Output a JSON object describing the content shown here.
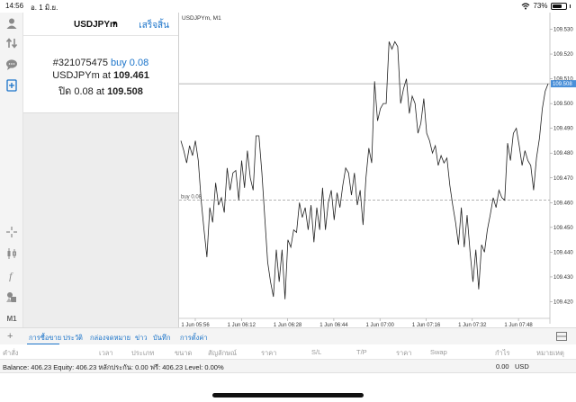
{
  "status": {
    "time": "14:56",
    "date": "อ. 1 มิ.ย.",
    "battery": "73%",
    "battery_level": 0.73
  },
  "panel": {
    "symbol": "USDJPYm",
    "done_label": "เสร็จสิ้น",
    "order_id": "#321075475",
    "order_action": "buy 0.08",
    "open_prefix": "USDJPYm at",
    "open_price": "109.461",
    "close_prefix": "ปิด 0.08 at",
    "close_price": "109.508"
  },
  "toolbar": {
    "timeframe_label": "M1"
  },
  "chart": {
    "title": "USDJPYm, M1",
    "buy_label": "buy 0.08",
    "current_price_label": "109.508"
  },
  "chart_data": {
    "type": "line",
    "title": "USDJPYm, M1",
    "y_ticks": [
      "109.530",
      "109.520",
      "109.510",
      "109.500",
      "109.490",
      "109.480",
      "109.470",
      "109.460",
      "109.450",
      "109.440",
      "109.430",
      "109.420"
    ],
    "x_ticks": [
      "1 Jun 05:56",
      "1 Jun 06:12",
      "1 Jun 06:28",
      "1 Jun 06:44",
      "1 Jun 07:00",
      "1 Jun 07:16",
      "1 Jun 07:32",
      "1 Jun 07:48"
    ],
    "ylim": [
      109.414,
      109.536
    ],
    "buy_level": 109.461,
    "current_level": 109.508,
    "grid": false,
    "y": [
      109.485,
      109.481,
      109.476,
      109.483,
      109.479,
      109.485,
      109.477,
      109.461,
      109.449,
      109.438,
      109.458,
      109.452,
      109.468,
      109.459,
      109.462,
      109.456,
      109.474,
      109.465,
      109.472,
      109.473,
      109.461,
      109.477,
      109.466,
      109.481,
      109.47,
      109.465,
      109.487,
      109.487,
      109.472,
      109.454,
      109.436,
      109.428,
      109.422,
      109.441,
      109.428,
      109.441,
      109.421,
      109.445,
      109.442,
      109.449,
      109.448,
      109.46,
      109.454,
      109.458,
      109.449,
      109.459,
      109.444,
      109.458,
      109.449,
      109.466,
      109.449,
      109.46,
      109.465,
      109.453,
      109.464,
      109.458,
      109.467,
      109.474,
      109.472,
      109.463,
      109.472,
      109.459,
      109.465,
      109.451,
      109.47,
      109.482,
      109.476,
      109.509,
      109.493,
      109.498,
      109.5,
      109.5,
      109.525,
      109.522,
      109.525,
      109.523,
      109.5,
      109.506,
      109.51,
      109.496,
      109.503,
      109.5,
      109.488,
      109.492,
      109.502,
      109.488,
      109.485,
      109.48,
      109.483,
      109.475,
      109.479,
      109.476,
      109.478,
      109.467,
      109.459,
      109.452,
      109.443,
      109.458,
      109.442,
      109.455,
      109.44,
      109.428,
      109.441,
      109.425,
      109.443,
      109.44,
      109.449,
      109.455,
      109.462,
      109.458,
      109.465,
      109.462,
      109.461,
      109.484,
      109.477,
      109.488,
      109.49,
      109.483,
      109.475,
      109.481,
      109.477,
      109.475,
      109.465,
      109.478,
      109.486,
      109.498,
      109.505,
      109.508
    ]
  },
  "tabs": {
    "items": [
      "การซื้อขาย",
      "ประวัติ",
      "กล่องจดหมาย",
      "ข่าว",
      "บันทึก",
      "การตั้งค่า"
    ]
  },
  "columns": [
    "คำสั่ง",
    "เวลา",
    "ประเภท",
    "ขนาด",
    "สัญลักษณ์",
    "ราคา",
    "S/L",
    "T/P",
    "ราคา",
    "Swap",
    "กำไร",
    "หมายเหตุ"
  ],
  "balance": {
    "text": "Balance: 406.23 Equity: 406.23 หลักประกัน: 0.00 ฟรี: 406.23 Level: 0.00%",
    "profit": "0.00",
    "currency": "USD"
  },
  "colors": {
    "accent": "#1a73c9",
    "line": "#222222",
    "buy_line": "#b5b5b5"
  }
}
